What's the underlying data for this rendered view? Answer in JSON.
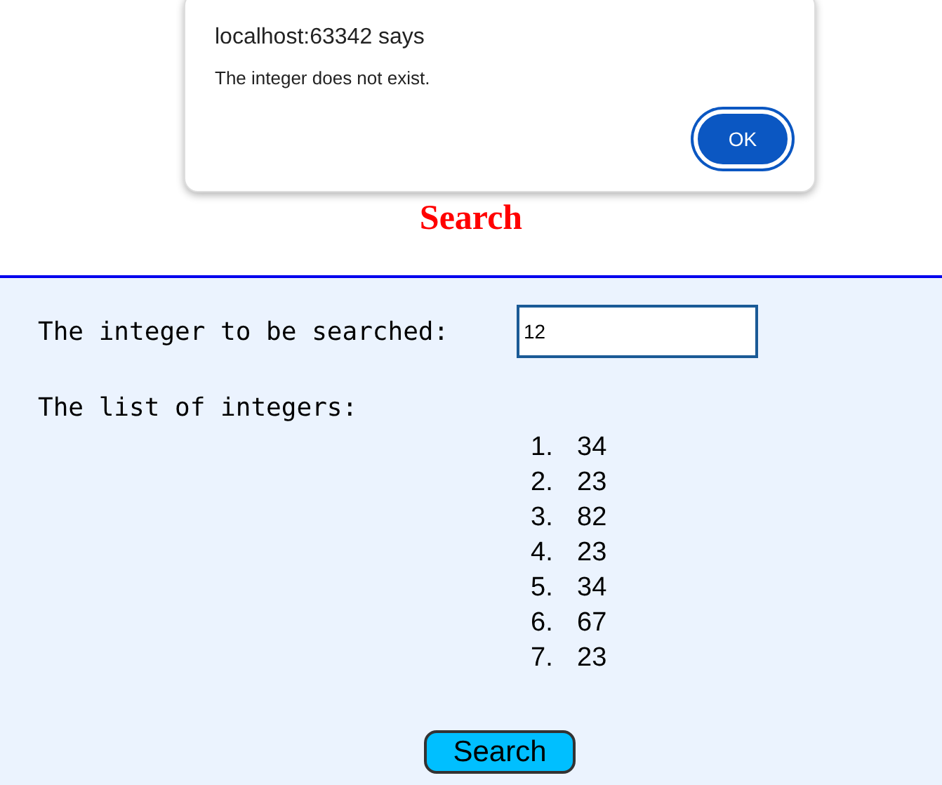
{
  "dialog": {
    "title": "localhost:63342 says",
    "message": "The integer does not exist.",
    "button": "OK"
  },
  "heading": "Search",
  "search_field": {
    "label": "The integer to be searched:",
    "value": "12"
  },
  "list": {
    "label": "The list of integers:",
    "items": [
      {
        "number": "1.",
        "value": "34"
      },
      {
        "number": "2.",
        "value": "23"
      },
      {
        "number": "3.",
        "value": "82"
      },
      {
        "number": "4.",
        "value": "23"
      },
      {
        "number": "5.",
        "value": "34"
      },
      {
        "number": "6.",
        "value": "67"
      },
      {
        "number": "7.",
        "value": "23"
      }
    ]
  },
  "button": "Search"
}
